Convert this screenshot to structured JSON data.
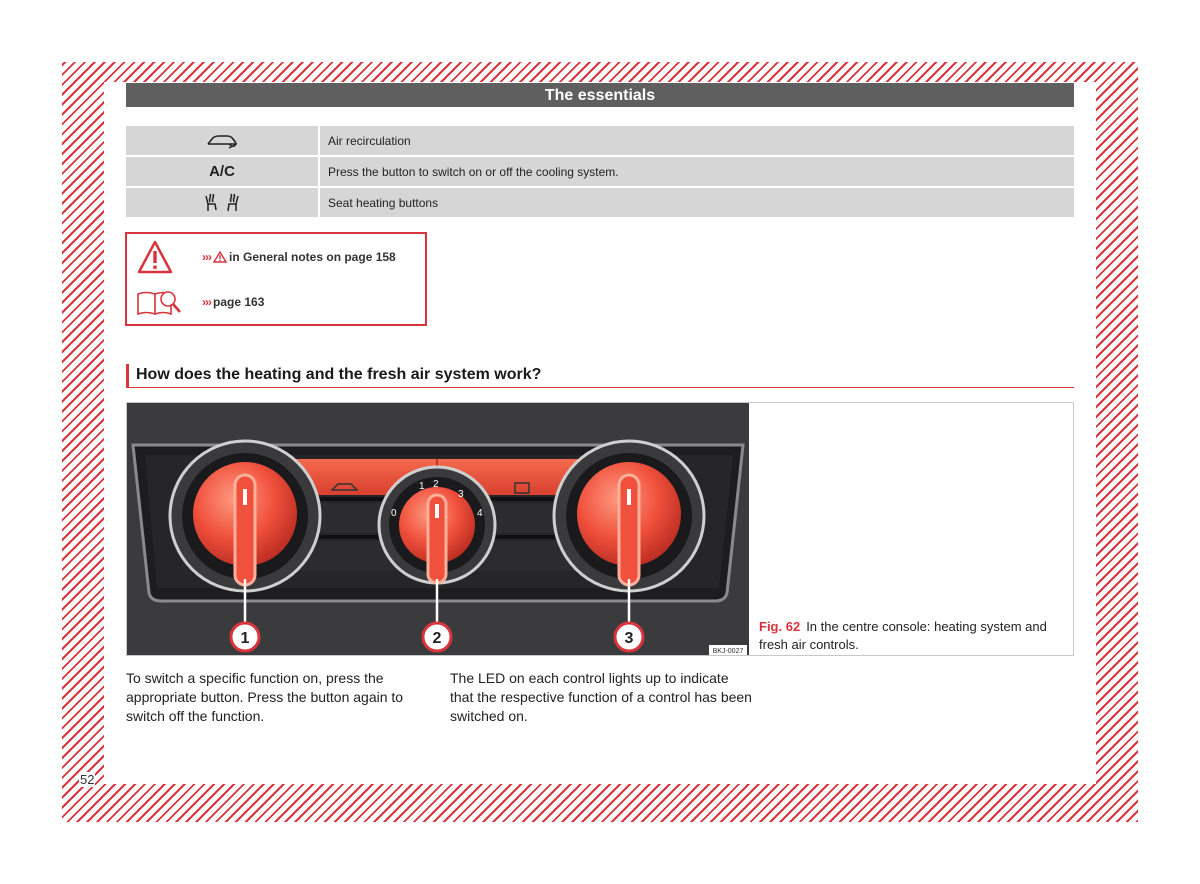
{
  "page_number": "52",
  "essentials": {
    "title": "The essentials",
    "rows": [
      {
        "icon": "air-recirculation-icon",
        "symbol_text": "",
        "text": "Air recirculation"
      },
      {
        "icon": "ac-icon",
        "symbol_text": "A/C",
        "text": "Press the button to switch on or off the cooling system."
      },
      {
        "icon": "seat-heating-icon",
        "symbol_text": "",
        "text": "Seat heating buttons"
      }
    ]
  },
  "warning_box": {
    "line1_arrows": "›››",
    "line1_text": " in General notes on page 158",
    "line2_arrows": "›››",
    "line2_text": " page 163"
  },
  "section": {
    "heading": "How does the heating and the fresh air system work?"
  },
  "figure": {
    "label": "Fig. 62",
    "caption": "In the centre console: heating system and fresh air controls.",
    "image_code": "BKJ-0027",
    "callouts": [
      "1",
      "2",
      "3"
    ],
    "fan_scale": [
      "0",
      "1",
      "2",
      "3",
      "4"
    ]
  },
  "body": {
    "col1": "To switch a specific function on, press the appropriate button. Press the button again to switch off the function.",
    "col2": "The LED on each control lights up to indicate that the respective function of a control has been switched on."
  },
  "colors": {
    "accent": "#d9343c",
    "header": "#5f5f5f",
    "table": "#d6d6d6"
  }
}
